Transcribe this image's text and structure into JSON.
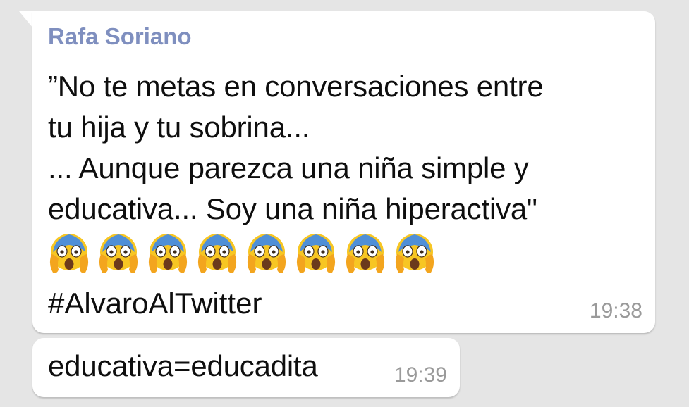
{
  "messages": [
    {
      "sender": "Rafa Soriano",
      "lines": [
        "”No te metas en conversaciones entre",
        "tu hija y tu sobrina...",
        "... Aunque parezca una niña simple y",
        "educativa... Soy una niña hiperactiva\""
      ],
      "emoji": "face-screaming-in-fear",
      "emoji_count": 8,
      "hashtag": "#AlvaroAlTwitter",
      "time": "19:38"
    },
    {
      "text": "educativa=educadita",
      "time": "19:39"
    }
  ],
  "colors": {
    "background": "#e5e5e5",
    "bubble": "#ffffff",
    "sender_name": "#7f8fbf",
    "timestamp": "#9a9a9a"
  }
}
